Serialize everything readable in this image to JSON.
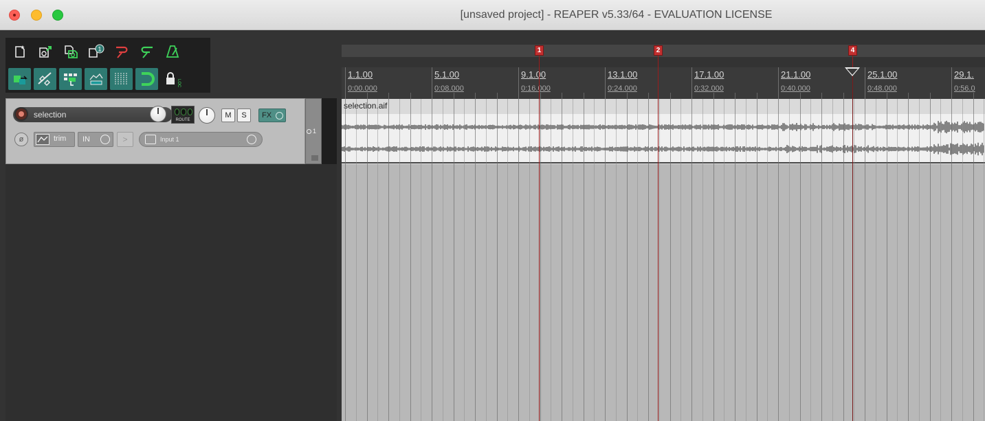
{
  "window": {
    "title": "[unsaved project] - REAPER v5.33/64 - EVALUATION LICENSE"
  },
  "toolbar": {
    "row1": [
      {
        "icon": "new-project-icon"
      },
      {
        "icon": "open-project-icon"
      },
      {
        "icon": "save-project-icon"
      },
      {
        "icon": "project-settings-icon"
      },
      {
        "icon": "undo-icon"
      },
      {
        "icon": "redo-icon"
      },
      {
        "icon": "metronome-icon"
      }
    ],
    "row2": [
      {
        "icon": "auto-crossfade-icon"
      },
      {
        "icon": "ripple-edit-icon"
      },
      {
        "icon": "item-grouping-icon"
      },
      {
        "icon": "envelope-points-icon"
      },
      {
        "icon": "grid-snap-icon"
      },
      {
        "icon": "snap-magnet-icon"
      },
      {
        "icon": "lock-icon"
      }
    ]
  },
  "track": {
    "name": "selection",
    "route_label": "ROUTE",
    "mute_label": "M",
    "solo_label": "S",
    "fx_label": "FX",
    "env_label": "trim",
    "in_label": "IN",
    "input_label": "Input 1",
    "number": "1",
    "item_name": "selection.aif"
  },
  "ruler": {
    "bars": [
      "1.1.00",
      "5.1.00",
      "9.1.00",
      "13.1.00",
      "17.1.00",
      "21.1.00",
      "25.1.00",
      "29.1."
    ],
    "times": [
      "0:00.000",
      "0:08.000",
      "0:16.000",
      "0:24.000",
      "0:32.000",
      "0:40.000",
      "0:48.000",
      "0:56.0"
    ]
  },
  "markers": [
    "1",
    "2",
    "4"
  ],
  "colors": {
    "marker": "#c23030",
    "fx_button": "#4f8f86",
    "toolbar_green": "#2e7a72"
  }
}
